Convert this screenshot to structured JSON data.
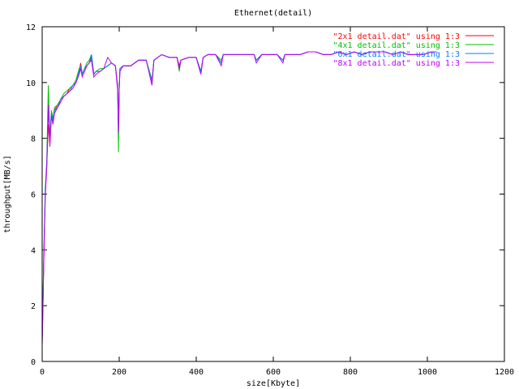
{
  "chart_data": {
    "type": "line",
    "title": "Ethernet(detail)",
    "xlabel": "size[Kbyte]",
    "ylabel": "throughput[MB/s]",
    "xlim": [
      0,
      1200
    ],
    "ylim": [
      0,
      12
    ],
    "xticks": [
      0,
      200,
      400,
      600,
      800,
      1000,
      1200
    ],
    "yticks": [
      0,
      2,
      4,
      6,
      8,
      10,
      12
    ],
    "grid": false,
    "legend_position": "top-right",
    "series": [
      {
        "name": "\"2x1 detail.dat\" using 1:3",
        "color": "#ff0000",
        "x": [
          0,
          2,
          4,
          6,
          8,
          12,
          16,
          20,
          24,
          28,
          32,
          40,
          48,
          56,
          64,
          72,
          80,
          88,
          96,
          100,
          104,
          110,
          116,
          122,
          128,
          134,
          140,
          150,
          160,
          170,
          180,
          190,
          196,
          198,
          200,
          202,
          210,
          230,
          250,
          270,
          285,
          290,
          300,
          310,
          330,
          350,
          356,
          360,
          380,
          400,
          412,
          418,
          430,
          450,
          465,
          470,
          490,
          510,
          530,
          550,
          556,
          570,
          590,
          610,
          625,
          630,
          650,
          670,
          690,
          710,
          730,
          750,
          770,
          790,
          810,
          830,
          850,
          870,
          890,
          910,
          930,
          950,
          970,
          990,
          1010,
          1024
        ],
        "y": [
          0.6,
          2.0,
          3.5,
          4.8,
          6.0,
          7.0,
          8.5,
          7.8,
          8.8,
          8.6,
          9.0,
          9.2,
          9.4,
          9.5,
          9.6,
          9.8,
          9.9,
          10.0,
          10.4,
          10.7,
          10.3,
          10.5,
          10.6,
          10.7,
          10.9,
          10.3,
          10.4,
          10.4,
          10.5,
          10.6,
          10.7,
          10.6,
          9.9,
          8.3,
          9.8,
          10.5,
          10.6,
          10.6,
          10.8,
          10.8,
          10.0,
          10.8,
          10.9,
          11.0,
          10.9,
          10.9,
          10.6,
          10.8,
          10.9,
          10.9,
          10.3,
          10.9,
          11.0,
          11.0,
          10.7,
          11.0,
          11.0,
          11.0,
          11.0,
          11.0,
          10.8,
          11.0,
          11.0,
          11.0,
          10.8,
          11.0,
          11.0,
          11.0,
          11.1,
          11.1,
          11.0,
          11.0,
          11.1,
          11.0,
          11.1,
          11.0,
          11.1,
          11.1,
          11.1,
          11.0,
          11.1,
          11.0,
          11.0,
          11.0,
          11.1,
          11.1
        ]
      },
      {
        "name": "\"4x1 detail.dat\" using 1:3",
        "color": "#00c000",
        "x": [
          0,
          2,
          4,
          6,
          8,
          12,
          16,
          20,
          24,
          28,
          32,
          40,
          48,
          56,
          64,
          72,
          80,
          88,
          96,
          100,
          104,
          110,
          116,
          122,
          128,
          134,
          140,
          150,
          160,
          170,
          180,
          190,
          196,
          198,
          200,
          202,
          210,
          230,
          250,
          270,
          285,
          290,
          300,
          310,
          330,
          350,
          356,
          360,
          380,
          400,
          412,
          418,
          430,
          450,
          465,
          470,
          490,
          510,
          530,
          550,
          556,
          570,
          590,
          610,
          625,
          630,
          650,
          670,
          690,
          710,
          730,
          750,
          770,
          790,
          810,
          830,
          850,
          870,
          890,
          910,
          930,
          950,
          970,
          990,
          1010,
          1024
        ],
        "y": [
          0.8,
          2.2,
          3.8,
          5.0,
          6.2,
          7.2,
          9.9,
          8.0,
          9.0,
          8.7,
          9.1,
          9.2,
          9.4,
          9.6,
          9.7,
          9.8,
          9.9,
          10.1,
          10.5,
          10.6,
          10.3,
          10.5,
          10.7,
          10.8,
          11.0,
          10.3,
          10.4,
          10.5,
          10.5,
          10.6,
          10.7,
          10.6,
          9.8,
          7.5,
          9.7,
          10.5,
          10.6,
          10.6,
          10.8,
          10.8,
          10.1,
          10.8,
          10.9,
          11.0,
          10.9,
          10.9,
          10.4,
          10.8,
          10.9,
          10.9,
          10.4,
          10.9,
          11.0,
          11.0,
          10.8,
          11.0,
          11.0,
          11.0,
          11.0,
          11.0,
          10.8,
          11.0,
          11.0,
          11.0,
          10.8,
          11.0,
          11.0,
          11.0,
          11.1,
          11.1,
          11.0,
          11.0,
          11.1,
          11.0,
          11.1,
          11.0,
          11.1,
          11.1,
          11.1,
          11.0,
          11.1,
          11.0,
          11.0,
          11.0,
          11.1,
          11.1
        ]
      },
      {
        "name": "\"6x1 detail.dat\" using 1:3",
        "color": "#0080ff",
        "x": [
          0,
          2,
          4,
          6,
          8,
          12,
          16,
          20,
          24,
          28,
          32,
          40,
          48,
          56,
          64,
          72,
          80,
          88,
          96,
          100,
          104,
          110,
          116,
          122,
          128,
          134,
          140,
          150,
          160,
          170,
          180,
          190,
          196,
          198,
          200,
          202,
          210,
          230,
          250,
          270,
          285,
          290,
          300,
          310,
          330,
          350,
          356,
          360,
          380,
          400,
          412,
          418,
          430,
          450,
          465,
          470,
          490,
          510,
          530,
          550,
          556,
          570,
          590,
          610,
          625,
          630,
          650,
          670,
          690,
          710,
          730,
          750,
          770,
          790,
          810,
          830,
          850,
          870,
          890,
          910,
          930,
          950,
          970,
          990,
          1010,
          1024
        ],
        "y": [
          0.7,
          2.1,
          3.6,
          4.9,
          6.1,
          7.1,
          9.1,
          7.9,
          8.9,
          8.6,
          9.0,
          9.1,
          9.4,
          9.5,
          9.6,
          9.7,
          9.9,
          10.0,
          10.4,
          10.6,
          10.3,
          10.5,
          10.6,
          10.7,
          11.0,
          10.3,
          10.4,
          10.4,
          10.5,
          10.6,
          10.7,
          10.6,
          9.8,
          8.2,
          9.8,
          10.5,
          10.6,
          10.6,
          10.8,
          10.8,
          10.0,
          10.8,
          10.9,
          11.0,
          10.9,
          10.9,
          10.5,
          10.8,
          10.9,
          10.9,
          10.4,
          10.9,
          11.0,
          11.0,
          10.7,
          11.0,
          11.0,
          11.0,
          11.0,
          11.0,
          10.8,
          11.0,
          11.0,
          11.0,
          10.8,
          11.0,
          11.0,
          11.0,
          11.1,
          11.1,
          11.0,
          11.0,
          11.1,
          11.0,
          11.1,
          11.0,
          11.1,
          11.1,
          11.1,
          11.0,
          11.1,
          11.0,
          11.0,
          11.0,
          11.1,
          11.1
        ]
      },
      {
        "name": "\"8x1 detail.dat\" using 1:3",
        "color": "#c000ff",
        "x": [
          0,
          2,
          4,
          6,
          8,
          12,
          16,
          20,
          24,
          28,
          32,
          40,
          48,
          56,
          64,
          72,
          80,
          88,
          96,
          100,
          104,
          110,
          116,
          122,
          128,
          134,
          140,
          150,
          160,
          170,
          180,
          190,
          196,
          198,
          200,
          202,
          210,
          230,
          250,
          270,
          285,
          290,
          300,
          310,
          330,
          350,
          356,
          360,
          380,
          400,
          412,
          418,
          430,
          450,
          465,
          470,
          490,
          510,
          530,
          550,
          556,
          570,
          590,
          610,
          625,
          630,
          650,
          670,
          690,
          710,
          730,
          750,
          770,
          790,
          810,
          830,
          850,
          870,
          890,
          910,
          930,
          950,
          970,
          990,
          1010,
          1024
        ],
        "y": [
          0.6,
          2.0,
          3.4,
          4.7,
          5.9,
          7.0,
          9.2,
          7.7,
          8.8,
          8.5,
          8.9,
          9.1,
          9.3,
          9.5,
          9.6,
          9.7,
          9.8,
          10.0,
          10.3,
          10.5,
          10.2,
          10.4,
          10.6,
          10.7,
          10.8,
          10.2,
          10.3,
          10.4,
          10.5,
          10.9,
          10.7,
          10.6,
          9.7,
          8.2,
          9.7,
          10.4,
          10.6,
          10.6,
          10.8,
          10.8,
          9.9,
          10.8,
          10.9,
          11.0,
          10.9,
          10.9,
          10.5,
          10.8,
          10.9,
          10.9,
          10.3,
          10.9,
          11.0,
          11.0,
          10.6,
          11.0,
          11.0,
          11.0,
          11.0,
          11.0,
          10.7,
          11.0,
          11.0,
          11.0,
          10.7,
          11.0,
          11.0,
          11.0,
          11.1,
          11.1,
          11.0,
          11.0,
          11.1,
          11.0,
          11.1,
          11.0,
          11.1,
          11.1,
          11.1,
          11.0,
          11.1,
          11.0,
          11.0,
          11.0,
          11.1,
          11.1
        ]
      }
    ]
  }
}
